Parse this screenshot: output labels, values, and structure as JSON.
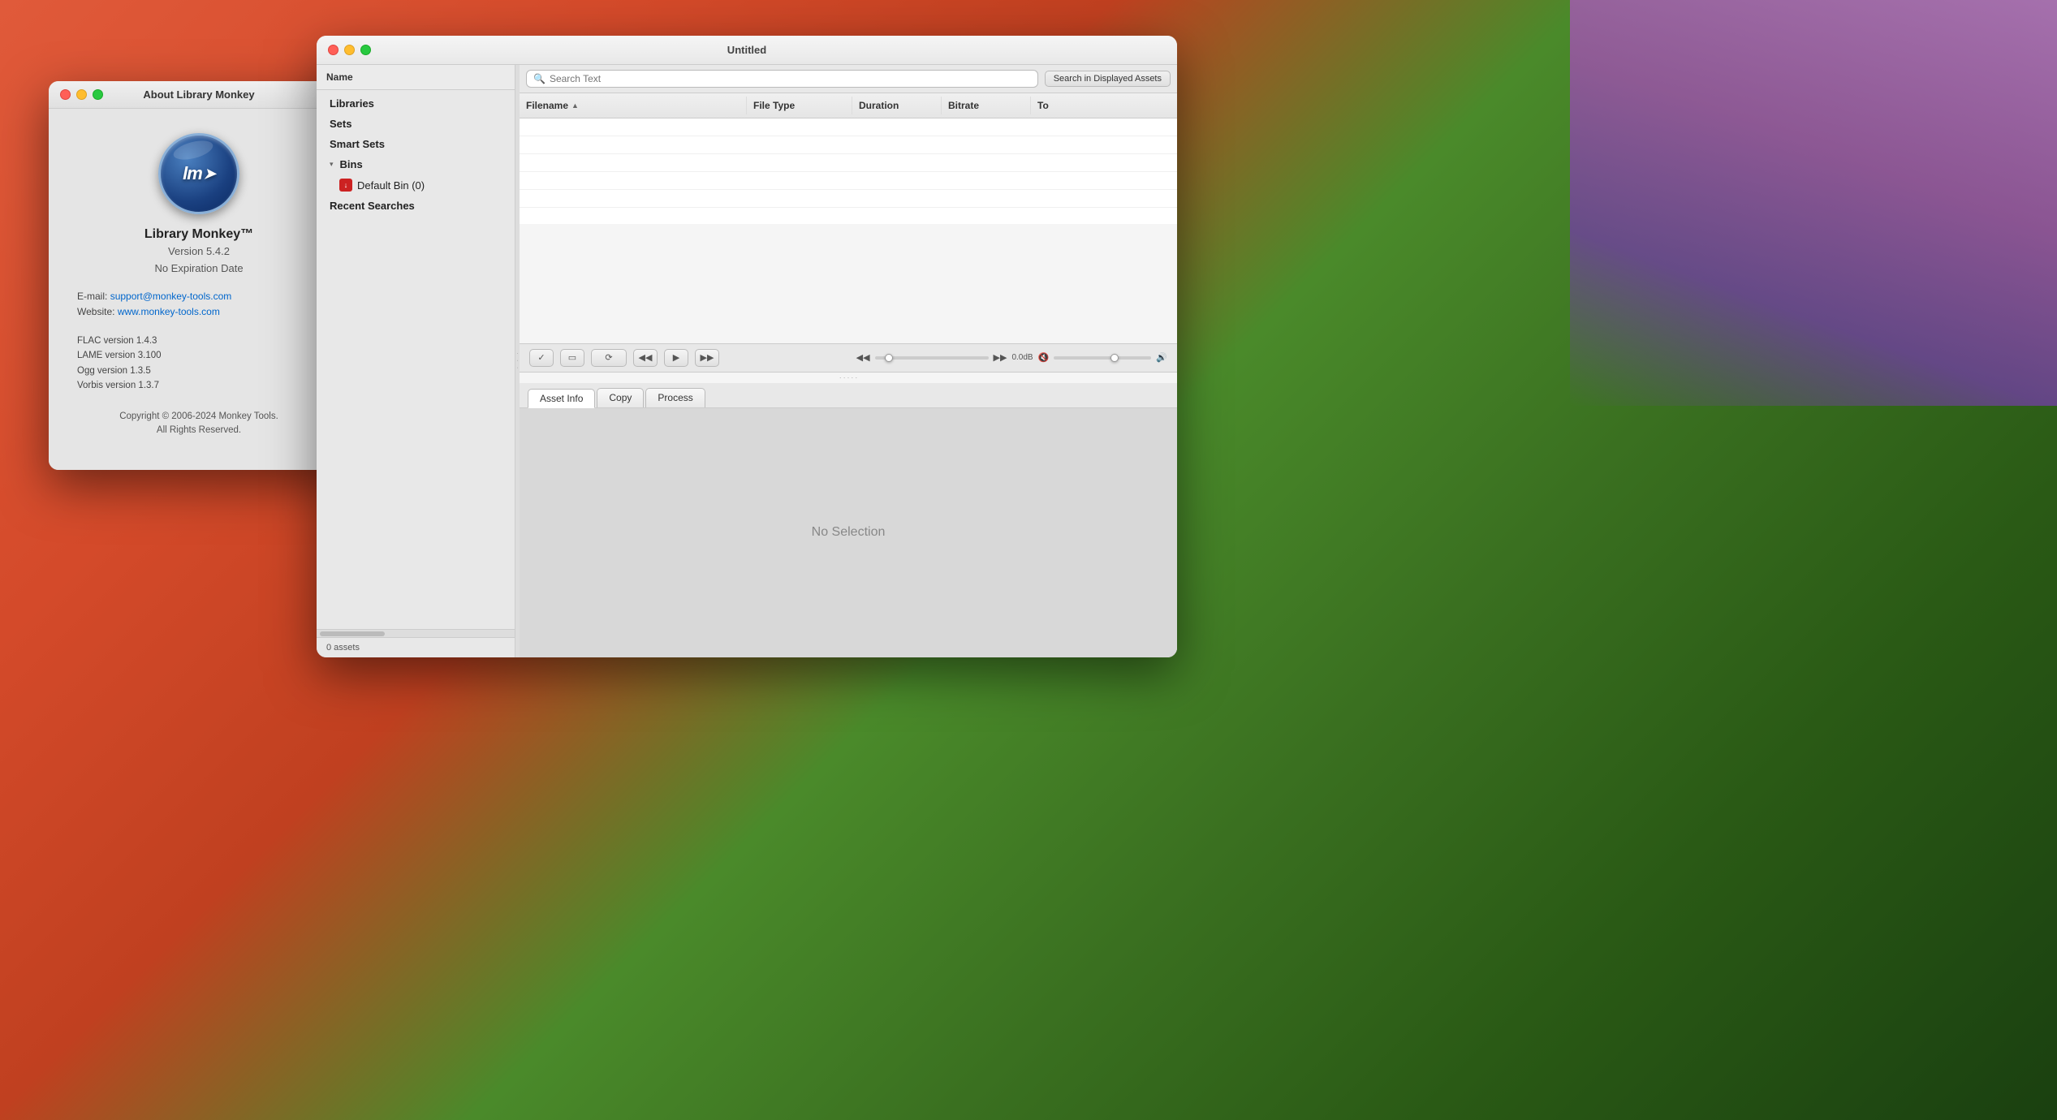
{
  "desktop": {},
  "about_window": {
    "title": "About Library Monkey",
    "logo_letters": "lm",
    "app_name": "Library Monkey™",
    "version": "Version 5.4.2",
    "expiry": "No Expiration Date",
    "email_label": "E-mail:",
    "email": "support@monkey-tools.com",
    "website_label": "Website:",
    "website": "www.monkey-tools.com",
    "libs": "FLAC version 1.4.3\nLAME version 3.100\nOgg version 1.3.5\nVorbis version 1.3.7",
    "lib_flac": "FLAC version 1.4.3",
    "lib_lame": "LAME version 3.100",
    "lib_ogg": "Ogg version 1.3.5",
    "lib_vorbis": "Vorbis version 1.3.7",
    "copyright": "Copyright © 2006-2024 Monkey Tools.\nAll Rights Reserved.",
    "copyright_line1": "Copyright © 2006-2024 Monkey Tools.",
    "copyright_line2": "All Rights Reserved."
  },
  "main_window": {
    "title": "Untitled",
    "search": {
      "placeholder": "Search Text",
      "button_label": "Search in Displayed Assets"
    },
    "table": {
      "columns": [
        "Filename",
        "File Type",
        "Duration",
        "Bitrate",
        "To"
      ],
      "rows": []
    },
    "transport": {
      "check_label": "✓",
      "screen_label": "▭",
      "loop_label": "⟳",
      "rewind_label": "◀◀",
      "play_label": "▶",
      "forward_label": "▶▶",
      "vol_skip_back": "◀◀",
      "vol_skip_fwd": "▶▶",
      "db_label": "0.0dB",
      "vol_icon_left": "🔇",
      "vol_icon_right": "🔊"
    },
    "tabs": {
      "asset_info": "Asset Info",
      "copy": "Copy",
      "process": "Process"
    },
    "no_selection": "No Selection",
    "status_bar": "0 assets"
  },
  "sidebar": {
    "header": "Name",
    "items": [
      {
        "label": "Libraries",
        "indent": 0,
        "type": "item"
      },
      {
        "label": "Sets",
        "indent": 0,
        "type": "item"
      },
      {
        "label": "Smart Sets",
        "indent": 0,
        "type": "item"
      },
      {
        "label": "Bins",
        "indent": 0,
        "type": "disclosure",
        "expanded": true
      },
      {
        "label": "Default Bin (0)",
        "indent": 1,
        "type": "bin"
      },
      {
        "label": "Recent Searches",
        "indent": 0,
        "type": "item"
      }
    ]
  }
}
